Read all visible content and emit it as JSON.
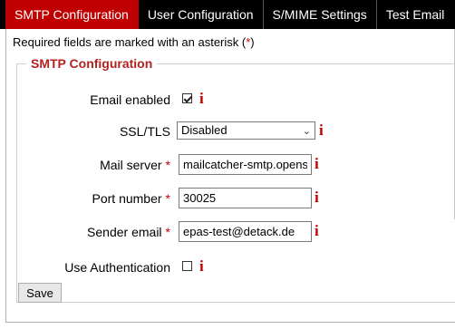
{
  "tabs": [
    {
      "label": "SMTP Configuration",
      "active": true
    },
    {
      "label": "User Configuration",
      "active": false
    },
    {
      "label": "S/MIME Settings",
      "active": false
    },
    {
      "label": "Test Email",
      "active": false
    }
  ],
  "required_note": {
    "text_before": "Required fields are marked with an asterisk (",
    "asterisk": "*",
    "text_after": ")"
  },
  "section": {
    "legend": "SMTP Configuration"
  },
  "fields": {
    "email_enabled": {
      "label": "Email enabled",
      "checked": true,
      "info": "i"
    },
    "ssl_tls": {
      "label": "SSL/TLS",
      "value": "Disabled",
      "info": "i"
    },
    "mail_server": {
      "label": "Mail server",
      "required_mark": "*",
      "value": "mailcatcher-smtp.opensh",
      "info": "i"
    },
    "port_number": {
      "label": "Port number",
      "required_mark": "*",
      "value": "30025",
      "info": "i"
    },
    "sender_email": {
      "label": "Sender email",
      "required_mark": "*",
      "value": "epas-test@detack.de",
      "info": "i"
    },
    "use_authentication": {
      "label": "Use Authentication",
      "checked": false,
      "info": "i"
    }
  },
  "save_label": "Save",
  "colors": {
    "accent": "#c00000",
    "legend": "#b22222",
    "tabbar": "#000000"
  }
}
